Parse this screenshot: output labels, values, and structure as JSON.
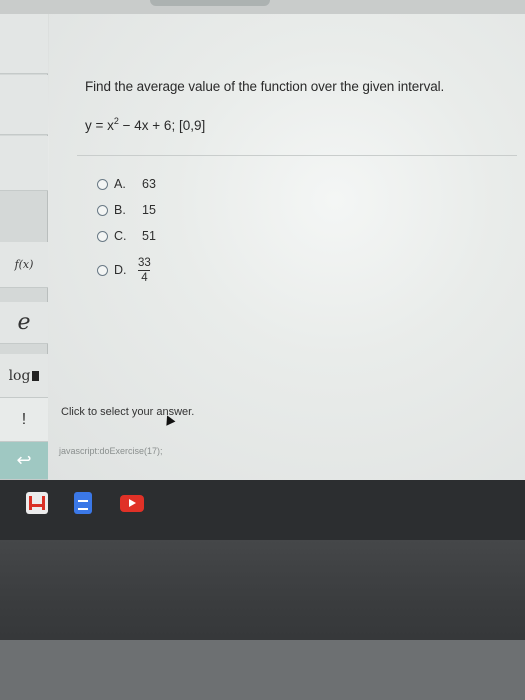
{
  "question": {
    "prompt": "Find the average value of the function over the given interval.",
    "function_prefix": "y = x",
    "function_exp": "2",
    "function_suffix": " − 4x + 6; [0,9]"
  },
  "options": [
    {
      "letter": "A.",
      "value": "63"
    },
    {
      "letter": "B.",
      "value": "15"
    },
    {
      "letter": "C.",
      "value": "51"
    },
    {
      "letter": "D.",
      "numerator": "33",
      "denominator": "4"
    }
  ],
  "toolbar": {
    "fx_label": "f(x)",
    "e_label": "e",
    "log_label": "log",
    "bang_label": "!",
    "back_label": "↩"
  },
  "hint": "Click to select your answer.",
  "status_url": "javascript:doExercise(17);",
  "taskbar": {
    "icons": [
      "gmail-icon",
      "google-docs-icon",
      "youtube-icon"
    ]
  }
}
